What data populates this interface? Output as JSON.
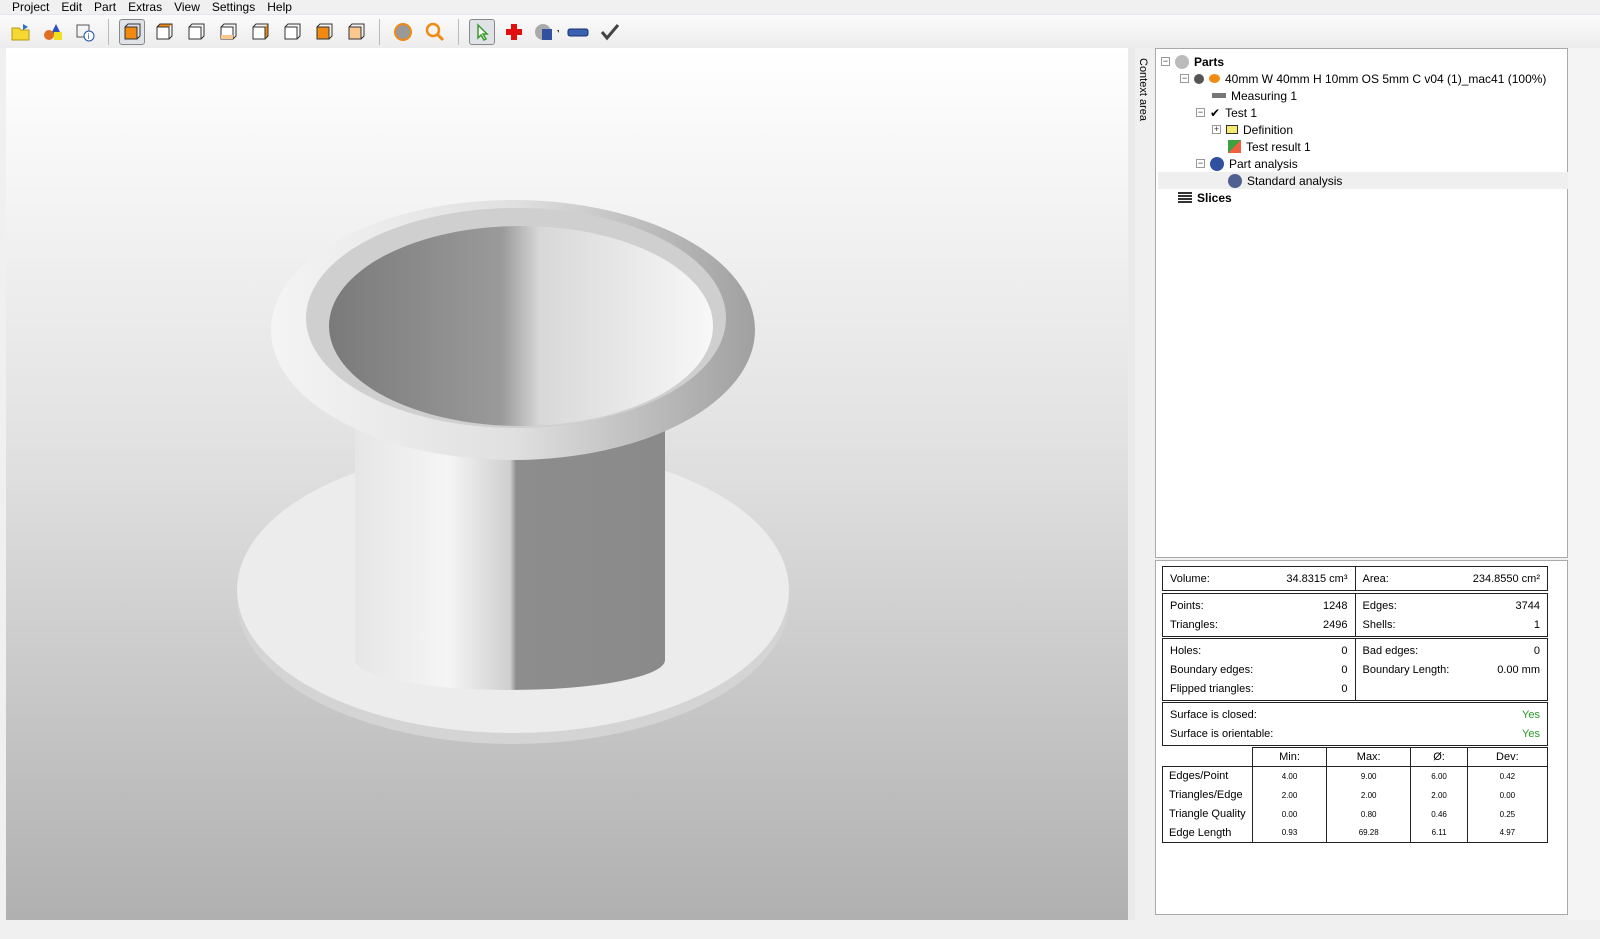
{
  "menu": [
    "Project",
    "Edit",
    "Part",
    "Extras",
    "View",
    "Settings",
    "Help"
  ],
  "toolbar": [
    "open-folder-icon",
    "primitives-icon",
    "part-info-icon",
    "view-iso-icon",
    "view-front-icon",
    "view-back-icon",
    "view-bottom-icon",
    "view-right-icon",
    "view-left-icon",
    "view-top-icon",
    "render-sphere-icon",
    "zoom-icon",
    "select-pointer-icon",
    "add-cross-icon",
    "analysis-icon",
    "measure-ruler-icon",
    "check-icon"
  ],
  "context_tab": "Context area",
  "tree": {
    "parts": "Parts",
    "part_name": "40mm W 40mm H 10mm OS 5mm C v04 (1)_mac41 (100%)",
    "measuring": "Measuring 1",
    "test": "Test 1",
    "definition": "Definition",
    "test_result": "Test result 1",
    "part_analysis": "Part analysis",
    "standard_analysis": "Standard analysis",
    "slices": "Slices"
  },
  "stats": {
    "volume_label": "Volume:",
    "volume": "34.8315 cm³",
    "area_label": "Area:",
    "area": "234.8550 cm²",
    "points_label": "Points:",
    "points": "1248",
    "triangles_label": "Triangles:",
    "triangles": "2496",
    "edges_label": "Edges:",
    "edges": "3744",
    "shells_label": "Shells:",
    "shells": "1",
    "holes_label": "Holes:",
    "holes": "0",
    "boundary_edges_label": "Boundary edges:",
    "boundary_edges": "0",
    "flipped_label": "Flipped triangles:",
    "flipped": "0",
    "bad_edges_label": "Bad edges:",
    "bad_edges": "0",
    "boundary_length_label": "Boundary Length:",
    "boundary_length": "0.00 mm",
    "closed_label": "Surface is closed:",
    "closed": "Yes",
    "orientable_label": "Surface is orientable:",
    "orientable": "Yes",
    "status_color": "#2a9a2a",
    "headers": [
      "Min:",
      "Max:",
      "Ø:",
      "Dev:"
    ],
    "rows": [
      {
        "label": "Edges/Point",
        "values": [
          "4.00",
          "9.00",
          "6.00",
          "0.42"
        ]
      },
      {
        "label": "Triangles/Edge",
        "values": [
          "2.00",
          "2.00",
          "2.00",
          "0.00"
        ]
      },
      {
        "label": "Triangle Quality",
        "values": [
          "0.00",
          "0.80",
          "0.46",
          "0.25"
        ]
      },
      {
        "label": "Edge Length",
        "values": [
          "0.93",
          "69.28",
          "6.11",
          "4.97"
        ]
      }
    ]
  }
}
